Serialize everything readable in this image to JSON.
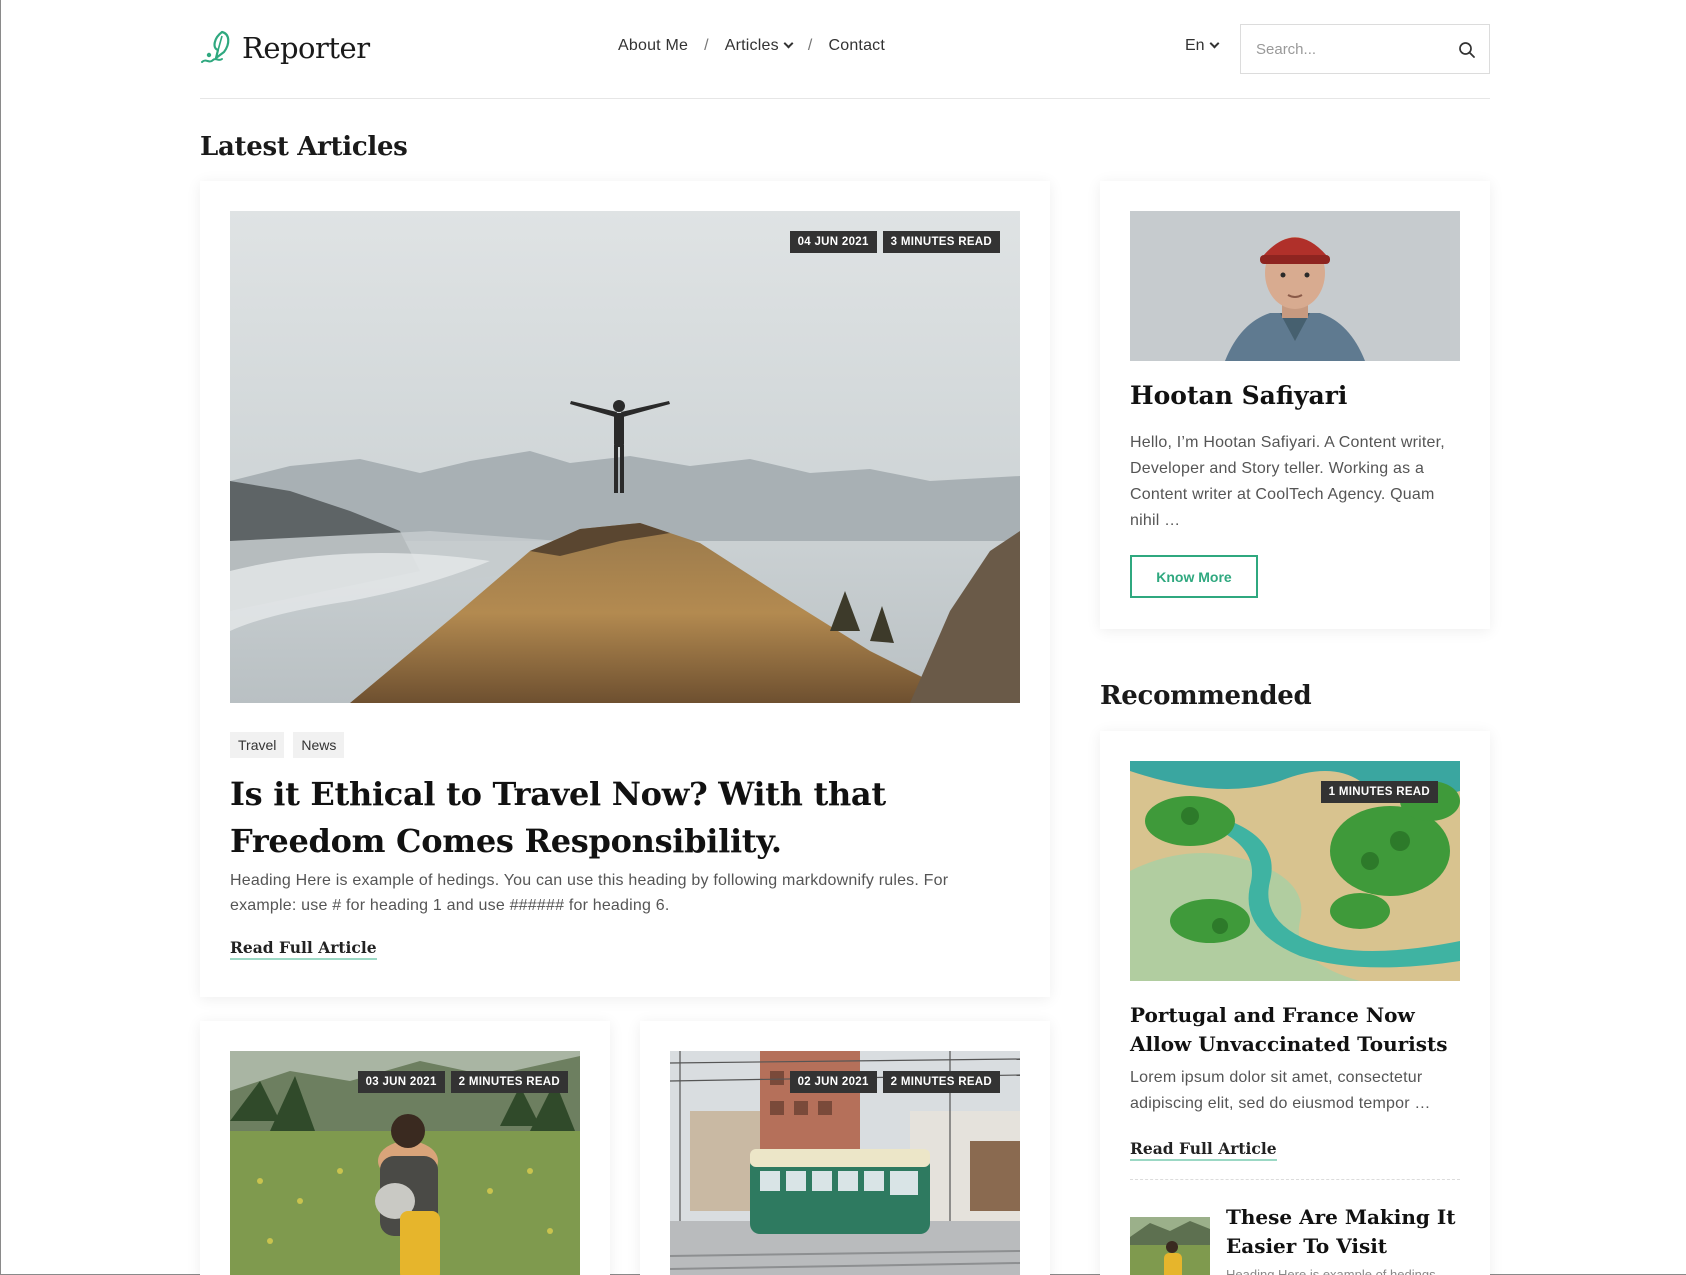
{
  "header": {
    "logo_text": "Reporter",
    "nav": [
      {
        "label": "About Me"
      },
      {
        "label": "Articles"
      },
      {
        "label": "Contact"
      }
    ],
    "separator": "/",
    "language": "En",
    "search_placeholder": "Search..."
  },
  "latest": {
    "heading": "Latest Articles",
    "featured": {
      "date": "04 JUN 2021",
      "read_time": "3 MINUTES READ",
      "tags": [
        "Travel",
        "News"
      ],
      "title": "Is it Ethical to Travel Now? With that Freedom Comes Responsibility.",
      "description": "Heading Here is example of hedings. You can use this heading by following markdownify rules. For example: use # for heading 1 and use ###### for heading 6.",
      "read_more": "Read Full Article"
    },
    "cards": [
      {
        "date": "03 JUN 2021",
        "read_time": "2 MINUTES READ"
      },
      {
        "date": "02 JUN 2021",
        "read_time": "2 MINUTES READ"
      }
    ]
  },
  "author": {
    "name": "Hootan Safiyari",
    "bio": "Hello, I’m Hootan Safiyari. A Content writer, Developer and Story teller. Working as a Content writer at CoolTech Agency. Quam nihil …",
    "button": "Know More"
  },
  "recommended": {
    "heading": "Recommended",
    "main": {
      "read_time": "1 MINUTES READ",
      "title": "Portugal and France Now Allow Unvaccinated Tourists",
      "description": "Lorem ipsum dolor sit amet, consectetur adipiscing elit, sed do eiusmod tempor …",
      "read_more": "Read Full Article"
    },
    "second": {
      "title": "These Are Making It Easier To Visit",
      "description": "Heading Here is example of hedings."
    }
  },
  "colors": {
    "accent": "#2fa87f",
    "badge_bg": "#333333",
    "link_underline": "#9bd8c4"
  }
}
